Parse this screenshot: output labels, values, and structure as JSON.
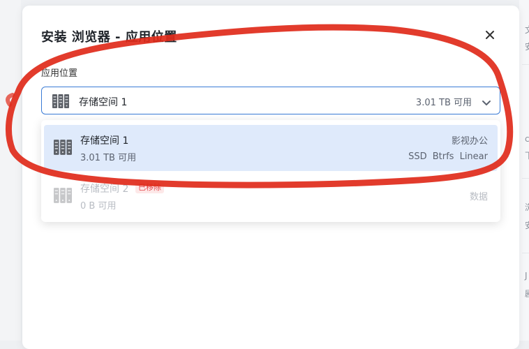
{
  "dialog": {
    "title": "安装 浏览器 - 应用位置",
    "close_icon": "close-icon",
    "field_label": "应用位置"
  },
  "select": {
    "current_name": "存储空间 1",
    "current_available": "3.01 TB 可用",
    "icon": "drive-array-icon",
    "chevron_icon": "chevron-down-icon"
  },
  "options": [
    {
      "name": "存储空间 1",
      "available": "3.01 TB 可用",
      "tag": "影视办公",
      "specs": "SSD  Btrfs  Linear",
      "selected": true
    },
    {
      "name": "存储空间 2",
      "badge": "已移除",
      "available": "0 B 可用",
      "tag": "数据",
      "disabled": true
    }
  ],
  "background_right_chars": [
    "文",
    "安",
    "c",
    "下",
    "浏",
    "安",
    "J",
    "剧"
  ],
  "colors": {
    "accent": "#3a7bd5",
    "selected_bg": "#dfeafb",
    "removed_badge": "#e5484d",
    "annotation": "#e02a1a"
  }
}
